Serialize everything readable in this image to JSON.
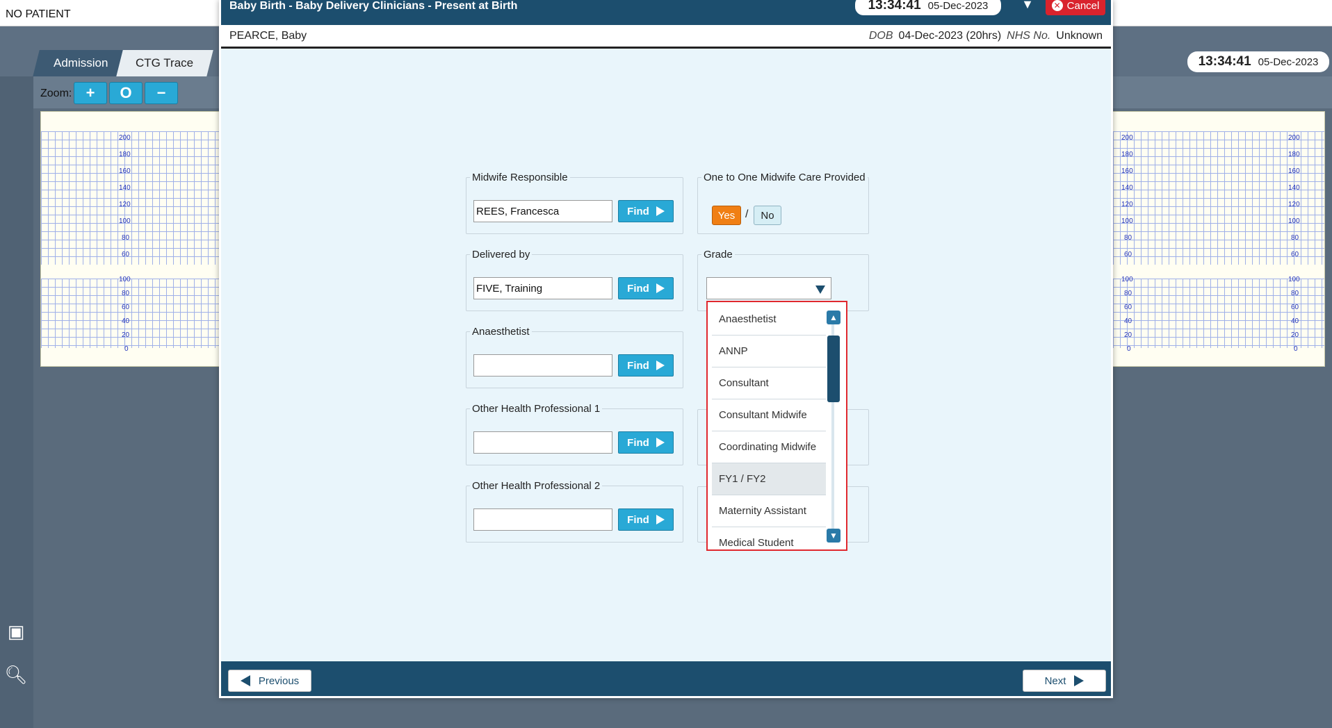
{
  "app": {
    "no_patient": "NO PATIENT",
    "tabs": [
      "Admission",
      "CTG Trace"
    ],
    "zoom_label": "Zoom:",
    "zoom_buttons": [
      "+",
      "O",
      "−"
    ],
    "clock_time": "13:34:41",
    "clock_date": "05-Dec-2023",
    "chart_ticks_top": [
      "200",
      "180",
      "160",
      "140",
      "120",
      "100",
      "80",
      "60"
    ],
    "chart_ticks_bottom": [
      "100",
      "80",
      "60",
      "40",
      "20",
      "0"
    ]
  },
  "modal": {
    "title": "Baby Birth - Baby Delivery Clinicians - Present at Birth",
    "clock_time": "13:34:41",
    "clock_date": "05-Dec-2023",
    "cancel_label": "Cancel",
    "patient": {
      "name": "PEARCE, Baby",
      "dob_label": "DOB",
      "dob_value": "04-Dec-2023 (20hrs)",
      "nhs_label": "NHS No.",
      "nhs_value": "Unknown"
    },
    "fields": {
      "midwife_responsible": {
        "label": "Midwife Responsible",
        "value": "REES, Francesca"
      },
      "delivered_by": {
        "label": "Delivered by",
        "value": "FIVE, Training"
      },
      "anaesthetist": {
        "label": "Anaesthetist",
        "value": ""
      },
      "ohp1": {
        "label": "Other Health Professional 1",
        "value": ""
      },
      "ohp2": {
        "label": "Other Health Professional 2",
        "value": ""
      },
      "find_label": "Find"
    },
    "one_to_one": {
      "label": "One to One Midwife Care Provided",
      "yes": "Yes",
      "slash": "/",
      "no": "No",
      "selected": "Yes"
    },
    "grade": {
      "label": "Grade",
      "value": "",
      "options": [
        "Anaesthetist",
        "ANNP",
        "Consultant",
        "Consultant Midwife",
        "Coordinating Midwife",
        "FY1 / FY2",
        "Maternity Assistant",
        "Medical Student"
      ],
      "highlighted": "FY1 / FY2"
    },
    "footer": {
      "previous": "Previous",
      "next": "Next"
    }
  },
  "colors": {
    "header": "#1c4e6e",
    "accent": "#29a9d6",
    "yes_selected": "#f07f14",
    "dropdown_border": "#e0282e"
  }
}
